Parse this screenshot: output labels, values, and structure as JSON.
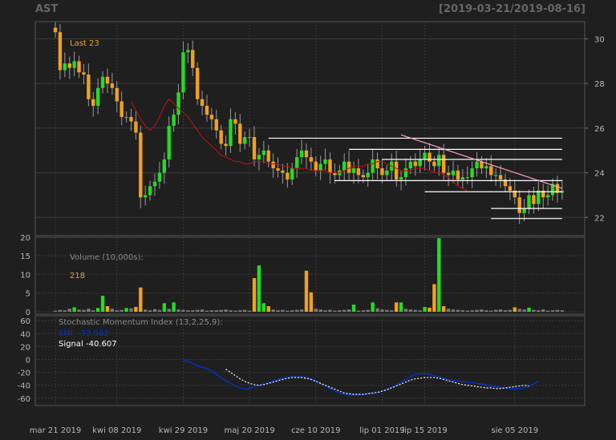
{
  "header": {
    "ticker": "AST",
    "date_range": "[2019-03-21/2019-08-16]"
  },
  "colors": {
    "up": "#22dd22",
    "down": "#f0a020",
    "ma": "#c01010",
    "smi": "#0033cc",
    "signal": "#ffffff",
    "grid": "#3a3a3a",
    "label": "#b8b8b8"
  },
  "chart_data": [
    {
      "type": "candlestick",
      "title": "",
      "annotation": "Last 23",
      "ylim": [
        21,
        31
      ],
      "ticks": [
        "22",
        "24",
        "26",
        "28",
        "30"
      ],
      "x_labels": [
        "mar 21 2019",
        "kwi 08 2019",
        "kwi 29 2019",
        "maj 20 2019",
        "cze 10 2019",
        "lip 01 2019",
        "lip 15 2019",
        "sie 05 2019"
      ],
      "x_label_index": [
        0,
        13,
        27,
        41,
        55,
        69,
        78,
        97
      ],
      "n_bars": 108,
      "close": [
        30.3,
        28.6,
        28.9,
        28.7,
        29.0,
        28.5,
        28.4,
        27.3,
        27.0,
        27.8,
        28.3,
        28.0,
        27.8,
        27.2,
        26.5,
        26.5,
        26.3,
        25.8,
        22.9,
        23.0,
        23.4,
        23.6,
        24.0,
        24.6,
        26.1,
        26.6,
        27.6,
        29.4,
        29.5,
        28.7,
        27.3,
        27.0,
        26.6,
        26.4,
        25.9,
        25.3,
        25.2,
        26.4,
        26.2,
        25.3,
        25.6,
        25.6,
        24.6,
        24.8,
        25.0,
        24.5,
        24.2,
        24.1,
        24.0,
        23.7,
        24.2,
        24.7,
        25.0,
        24.7,
        24.5,
        24.1,
        24.4,
        24.6,
        24.0,
        23.9,
        24.1,
        24.5,
        24.0,
        24.2,
        23.9,
        23.8,
        24.0,
        24.6,
        24.2,
        23.9,
        24.1,
        24.5,
        23.7,
        23.8,
        24.2,
        24.5,
        24.3,
        24.6,
        24.9,
        24.5,
        24.3,
        24.8,
        24.0,
        23.9,
        24.1,
        23.7,
        23.8,
        23.8,
        24.2,
        24.5,
        24.2,
        24.3,
        23.9,
        23.9,
        23.7,
        23.4,
        23.2,
        22.9,
        22.2,
        22.4,
        23.0,
        22.6,
        23.2,
        22.9,
        23.0,
        23.5,
        23.1,
        23.2
      ],
      "ma_x_start": 16,
      "ma": [
        27.2,
        26.8,
        26.4,
        26.1,
        25.9,
        26.1,
        26.5,
        27.0,
        27.3,
        27.1,
        26.9,
        26.7,
        26.5,
        26.2,
        25.9,
        25.6,
        25.4,
        25.2,
        25.0,
        24.8,
        24.7,
        24.6,
        24.5,
        24.5,
        24.4,
        24.4,
        24.5,
        24.5,
        24.5,
        24.4,
        24.4,
        24.4,
        24.3,
        24.3,
        24.2,
        24.2,
        24.2,
        24.2,
        24.1,
        24.1,
        24.1,
        24.1,
        24.0,
        24.0,
        24.0,
        24.1,
        24.2,
        24.3,
        24.3,
        24.3,
        24.4,
        24.4,
        24.5,
        24.5,
        24.4,
        24.3,
        24.2,
        24.1,
        24.1,
        24.1,
        24.2,
        24.2,
        24.2,
        24.1,
        24.0,
        24.0,
        23.9,
        23.8,
        23.6,
        23.4,
        23.3,
        23.2
      ],
      "hlines": [
        {
          "y": 25.55,
          "x0": 45,
          "x1": 107
        },
        {
          "y": 25.05,
          "x0": 62,
          "x1": 107
        },
        {
          "y": 24.6,
          "x0": 69,
          "x1": 107
        },
        {
          "y": 23.65,
          "x0": 59,
          "x1": 107
        },
        {
          "y": 23.15,
          "x0": 78,
          "x1": 107
        },
        {
          "y": 22.4,
          "x0": 92,
          "x1": 107
        },
        {
          "y": 21.95,
          "x0": 92,
          "x1": 107
        }
      ],
      "trendline": {
        "x0": 73,
        "y0": 25.7,
        "x1": 107,
        "y1": 23.3
      }
    },
    {
      "type": "bar",
      "title": "",
      "label": "Volume (10,000s):",
      "last_value": "218",
      "ylim": [
        0,
        20
      ],
      "ticks": [
        "0",
        "5",
        "10",
        "15",
        "20"
      ],
      "volume": [
        0.3,
        0.5,
        0.4,
        0.8,
        1.2,
        0.6,
        0.5,
        0.8,
        0.4,
        1.0,
        4.3,
        1.5,
        0.8,
        0.4,
        0.5,
        1.0,
        0.9,
        1.3,
        6.5,
        0.6,
        0.4,
        0.7,
        0.5,
        2.3,
        0.8,
        2.5,
        0.6,
        0.5,
        0.4,
        0.4,
        0.5,
        0.6,
        0.3,
        0.4,
        0.4,
        0.5,
        0.6,
        0.4,
        0.3,
        0.4,
        0.5,
        0.3,
        9.0,
        12.4,
        2.3,
        1.5,
        0.6,
        0.4,
        0.5,
        0.3,
        0.4,
        0.5,
        0.6,
        11.0,
        5.2,
        0.8,
        0.6,
        0.4,
        0.5,
        0.3,
        0.4,
        0.5,
        0.6,
        1.9,
        0.3,
        0.4,
        0.5,
        2.5,
        0.9,
        0.6,
        0.5,
        0.4,
        2.5,
        2.5,
        0.8,
        0.6,
        0.5,
        0.4,
        1.3,
        1.1,
        7.4,
        19.7,
        1.5,
        0.8,
        0.6,
        0.5,
        0.4,
        0.3,
        0.4,
        0.5,
        0.6,
        0.4,
        0.3,
        0.5,
        0.6,
        0.4,
        0.5,
        1.2,
        0.8,
        0.6,
        1.1,
        0.5,
        0.4,
        0.6,
        0.3,
        0.4,
        0.5,
        0.4
      ]
    },
    {
      "type": "line",
      "title": "Stochastic Momentum Index (13,2,25,9):",
      "ylim": [
        -66,
        66
      ],
      "ticks": [
        "-60",
        "-40",
        "-20",
        "0",
        "20",
        "40",
        "60"
      ],
      "series": [
        {
          "name": "SMI",
          "last_value": "-33.962",
          "x_start": 27,
          "values": [
            -1,
            -3,
            -6,
            -10,
            -12,
            -14,
            -18,
            -23,
            -28,
            -33,
            -37,
            -41,
            -44,
            -46,
            -45,
            -42,
            -40,
            -38,
            -36,
            -33,
            -31,
            -29,
            -28,
            -27,
            -27,
            -27,
            -28,
            -30,
            -33,
            -37,
            -41,
            -45,
            -49,
            -52,
            -54,
            -55,
            -55,
            -55,
            -54,
            -53,
            -52,
            -51,
            -49,
            -46,
            -43,
            -39,
            -35,
            -31,
            -27,
            -23,
            -22,
            -22,
            -23,
            -25,
            -27,
            -29,
            -31,
            -32,
            -33,
            -34,
            -35,
            -36,
            -37,
            -38,
            -39,
            -41,
            -42,
            -43,
            -44,
            -45,
            -45,
            -45,
            -44,
            -42,
            -38,
            -34
          ]
        },
        {
          "name": "Signal",
          "last_value": "-40.607",
          "x_start": 36,
          "values": [
            -15,
            -20,
            -25,
            -30,
            -34,
            -37,
            -39,
            -40,
            -39,
            -37,
            -35,
            -33,
            -31,
            -29,
            -28,
            -28,
            -28,
            -29,
            -31,
            -34,
            -37,
            -40,
            -43,
            -46,
            -49,
            -52,
            -53,
            -54,
            -54,
            -54,
            -53,
            -52,
            -51,
            -49,
            -47,
            -44,
            -41,
            -38,
            -35,
            -32,
            -30,
            -29,
            -28,
            -28,
            -28,
            -29,
            -31,
            -33,
            -35,
            -37,
            -39,
            -40,
            -41,
            -42,
            -43,
            -44,
            -44,
            -45,
            -45,
            -44,
            -43,
            -42,
            -41,
            -40,
            -41
          ]
        }
      ]
    }
  ]
}
